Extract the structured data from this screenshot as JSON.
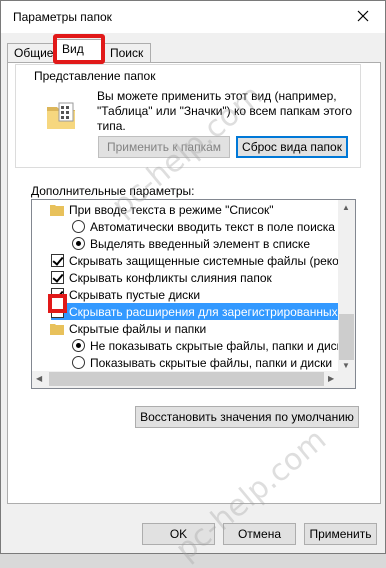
{
  "window": {
    "title": "Параметры папок"
  },
  "tabs": [
    {
      "label": "Общие"
    },
    {
      "label": "Вид"
    },
    {
      "label": "Поиск"
    }
  ],
  "folder_views": {
    "legend": "Представление папок",
    "description": "Вы можете применить этот вид (например, \"Таблица\" или \"Значки\") ко всем папкам этого типа.",
    "apply_button": "Применить к папкам",
    "reset_button": "Сброс вида папок"
  },
  "advanced": {
    "label": "Дополнительные параметры:",
    "items": [
      {
        "type": "folder",
        "text": "При вводе текста в режиме \"Список\""
      },
      {
        "type": "radio",
        "checked": false,
        "text": "Автоматически вводить текст в поле поиска"
      },
      {
        "type": "radio",
        "checked": true,
        "text": "Выделять введенный элемент в списке"
      },
      {
        "type": "checkbox",
        "checked": true,
        "text": "Скрывать защищенные системные файлы (рекомен,"
      },
      {
        "type": "checkbox",
        "checked": true,
        "text": "Скрывать конфликты слияния папок"
      },
      {
        "type": "checkbox",
        "checked": true,
        "text": "Скрывать пустые диски"
      },
      {
        "type": "checkbox",
        "checked": false,
        "selected": true,
        "text": "Скрывать расширения для зарегистрированных типо"
      },
      {
        "type": "folder",
        "text": "Скрытые файлы и папки"
      },
      {
        "type": "radio",
        "checked": true,
        "text": "Не показывать скрытые файлы, папки и диски"
      },
      {
        "type": "radio",
        "checked": false,
        "text": "Показывать скрытые файлы, папки и диски"
      }
    ],
    "restore_button": "Восстановить значения по умолчанию"
  },
  "footer": {
    "ok": "OK",
    "cancel": "Отмена",
    "apply": "Применить"
  },
  "watermark": "pc-help.com",
  "colors": {
    "highlight": "#3399ff",
    "annotation": "#e11919",
    "focus": "#0078d7"
  }
}
